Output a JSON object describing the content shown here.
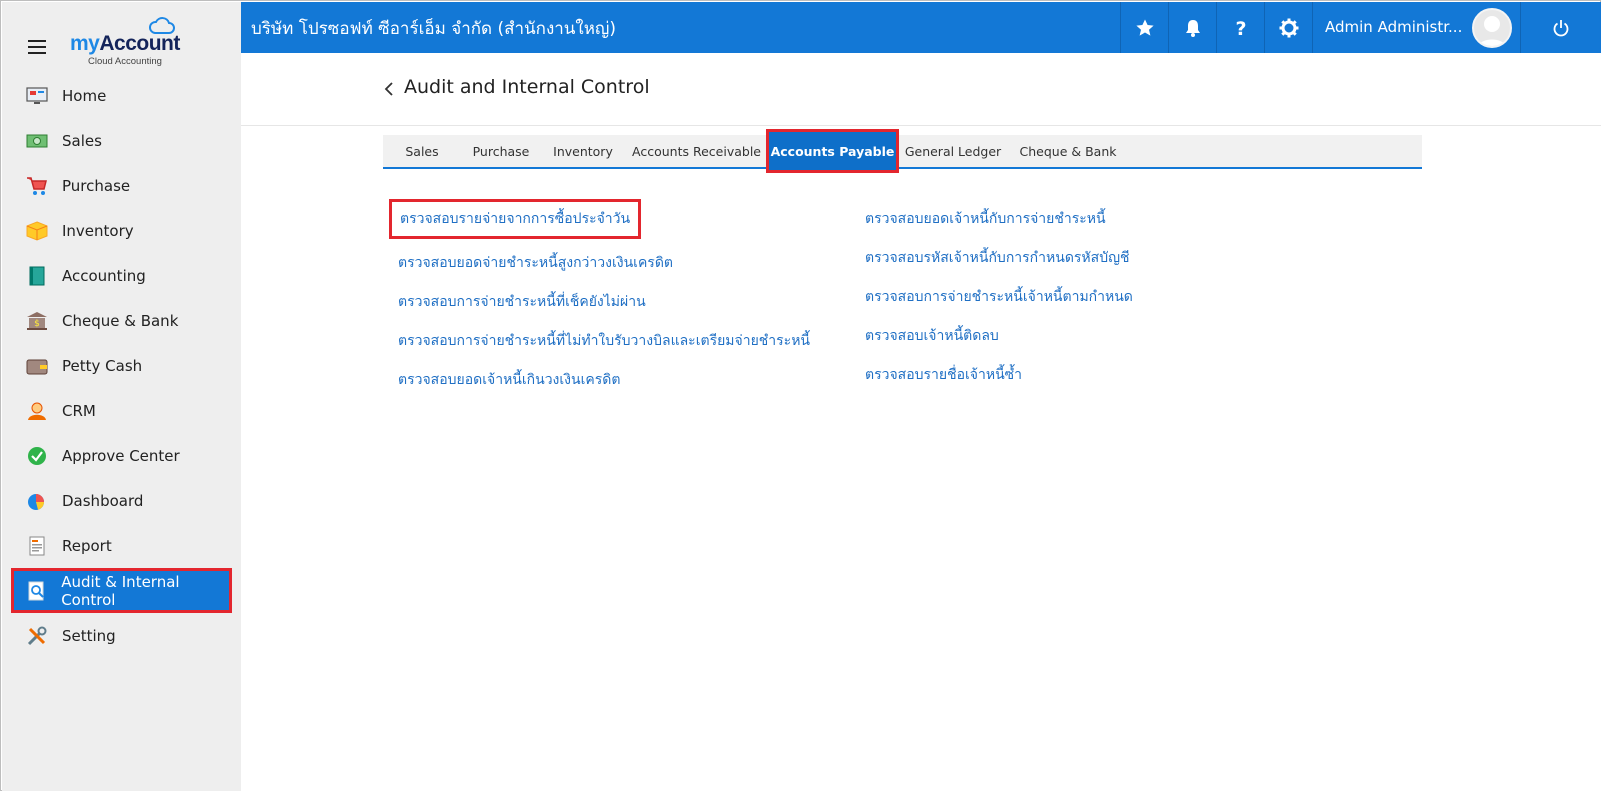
{
  "sidebar": {
    "logo": {
      "my": "my",
      "account": "Account",
      "sub": "Cloud Accounting"
    },
    "items": [
      {
        "label": "Home",
        "icon": "home-monitor-icon"
      },
      {
        "label": "Sales",
        "icon": "money-icon"
      },
      {
        "label": "Purchase",
        "icon": "cart-icon"
      },
      {
        "label": "Inventory",
        "icon": "box-icon"
      },
      {
        "label": "Accounting",
        "icon": "book-icon"
      },
      {
        "label": "Cheque & Bank",
        "icon": "bank-icon"
      },
      {
        "label": "Petty Cash",
        "icon": "wallet-icon"
      },
      {
        "label": "CRM",
        "icon": "person-icon"
      },
      {
        "label": "Approve Center",
        "icon": "check-circle-icon"
      },
      {
        "label": "Dashboard",
        "icon": "pie-chart-icon"
      },
      {
        "label": "Report",
        "icon": "report-icon"
      },
      {
        "label": "Audit & Internal Control",
        "icon": "audit-icon",
        "active": true
      },
      {
        "label": "Setting",
        "icon": "tools-icon"
      }
    ]
  },
  "topbar": {
    "company": "บริษัท โปรซอฟท์ ซีอาร์เอ็ม จำกัด (สำนักงานใหญ่)",
    "user_name": "Admin Administr...",
    "accent": "#1378d6"
  },
  "page": {
    "title": "Audit and Internal Control"
  },
  "tabs": [
    {
      "label": "Sales"
    },
    {
      "label": "Purchase"
    },
    {
      "label": "Inventory"
    },
    {
      "label": "Accounts Receivable"
    },
    {
      "label": "Accounts Payable",
      "active": true
    },
    {
      "label": "General Ledger"
    },
    {
      "label": "Cheque & Bank"
    }
  ],
  "links": {
    "left": [
      "ตรวจสอบรายจ่ายจากการซื้อประจำวัน",
      "ตรวจสอบยอดจ่ายชำระหนี้สูงกว่าวงเงินเครดิต",
      "ตรวจสอบการจ่ายชำระหนี้ที่เช็คยังไม่ผ่าน",
      "ตรวจสอบการจ่ายชำระหนี้ที่ไม่ทำใบรับวางบิลและเตรียมจ่ายชำระหนี้",
      "ตรวจสอบยอดเจ้าหนี้เกินวงเงินเครดิต"
    ],
    "right": [
      "ตรวจสอบยอดเจ้าหนี้กับการจ่ายชำระหนี้",
      "ตรวจสอบรหัสเจ้าหนี้กับการกำหนดรหัสบัญชี",
      "ตรวจสอบการจ่ายชำระหนี้เจ้าหนี้ตามกำหนด",
      "ตรวจสอบเจ้าหนี้ติดลบ",
      "ตรวจสอบรายชื่อเจ้าหนี้ซ้ำ"
    ]
  }
}
